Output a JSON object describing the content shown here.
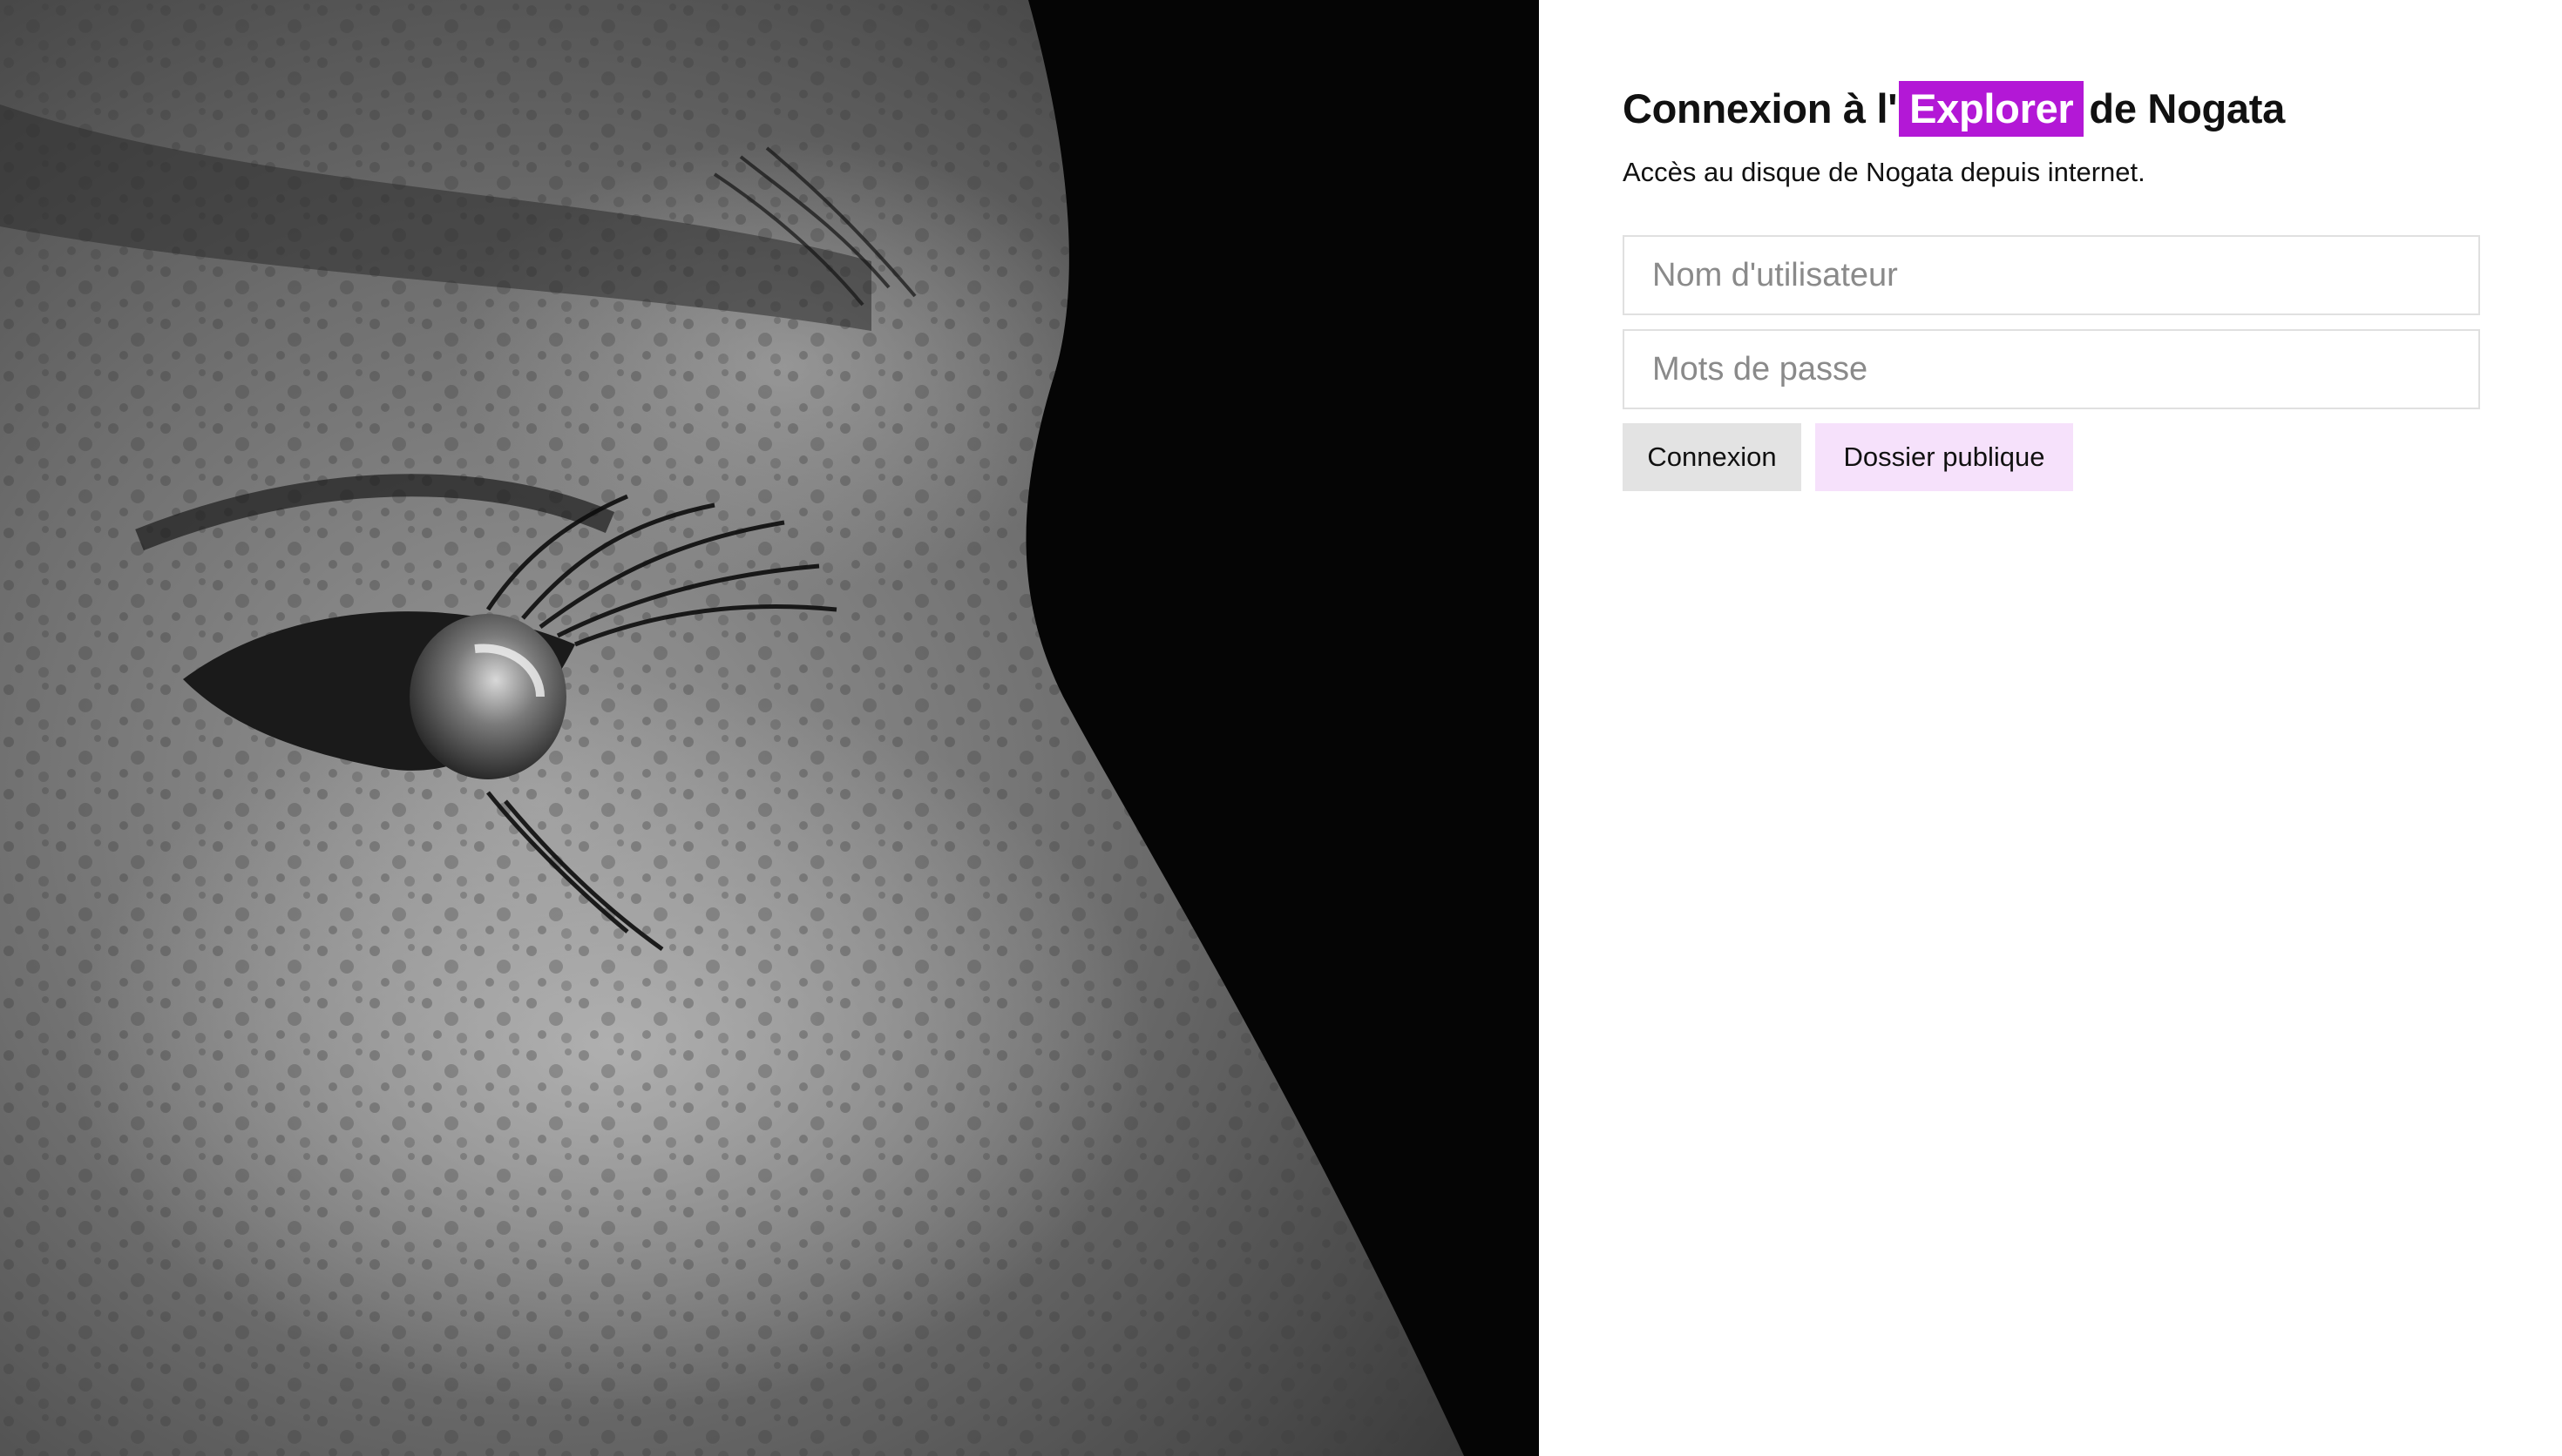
{
  "login": {
    "title_before": "Connexion à l'",
    "title_highlight": "Explorer",
    "title_after": "de Nogata",
    "subtitle": "Accès au disque de Nogata depuis internet.",
    "username_placeholder": "Nom d'utilisateur",
    "password_placeholder": "Mots de passe",
    "login_button": "Connexion",
    "public_folder_button": "Dossier publique"
  },
  "colors": {
    "accent": "#b318d6",
    "accent_light": "#f6e1fb",
    "button_gray": "#e3e3e3"
  }
}
